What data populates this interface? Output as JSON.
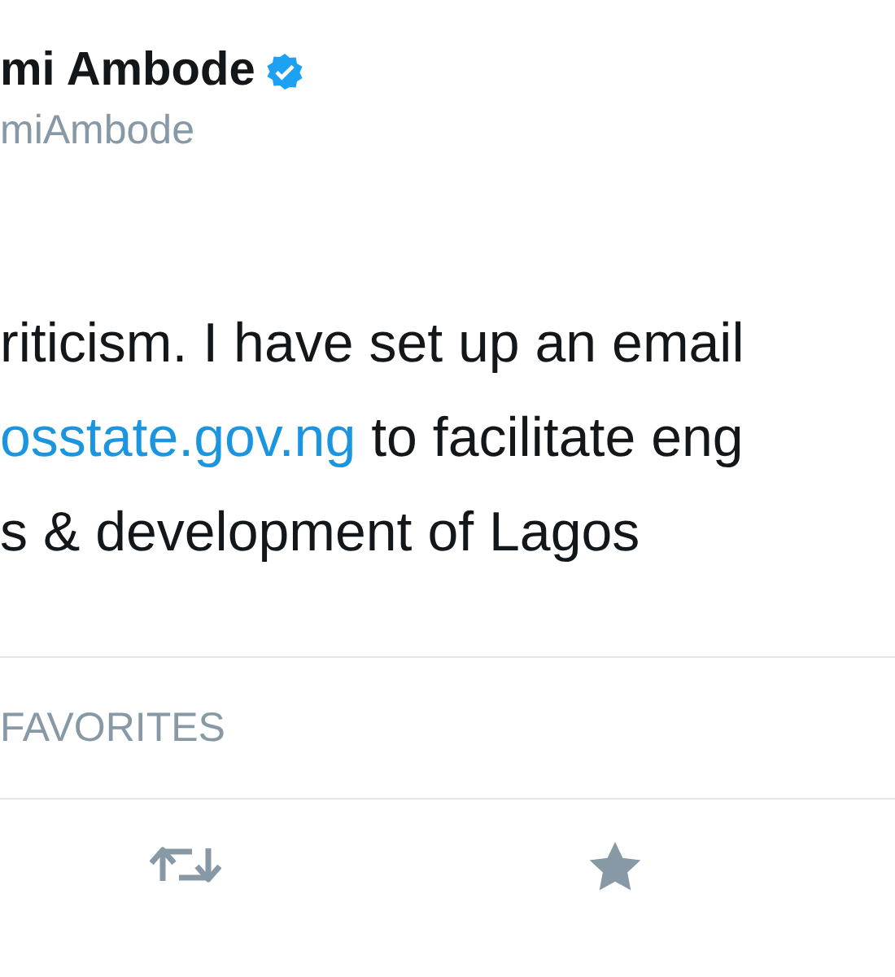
{
  "author": {
    "name": "mi Ambode",
    "verified": true,
    "handle": "miAmbode"
  },
  "tweet_lines": [
    {
      "parts": [
        {
          "kind": "text",
          "text": "riticism. I have set up an email"
        }
      ]
    },
    {
      "parts": [
        {
          "kind": "link",
          "text": "osstate.gov.ng"
        },
        {
          "kind": "text",
          "text": " to facilitate eng"
        }
      ]
    },
    {
      "parts": [
        {
          "kind": "text",
          "text": "s & development of Lagos"
        }
      ]
    }
  ],
  "stats": {
    "label": "FAVORITES"
  },
  "actions": [
    {
      "kind": "retweet"
    },
    {
      "kind": "favorite"
    }
  ]
}
